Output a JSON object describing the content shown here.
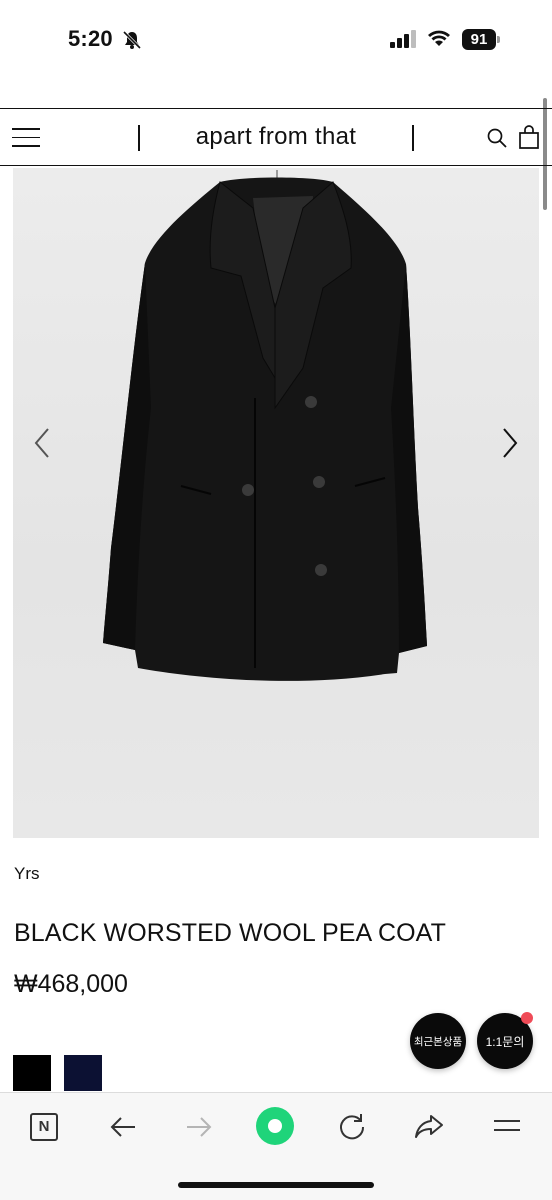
{
  "status_bar": {
    "time": "5:20",
    "battery": "91"
  },
  "header": {
    "title": "apart from that"
  },
  "product": {
    "brand": "Yrs",
    "name": "BLACK WORSTED WOOL PEA COAT",
    "price": "₩468,000",
    "colors": [
      "#000000",
      "#0c1133"
    ]
  },
  "floating_buttons": {
    "recent": "최근본상품",
    "inquiry": "1:1문의"
  },
  "toolbar": {
    "n_label": "N"
  }
}
